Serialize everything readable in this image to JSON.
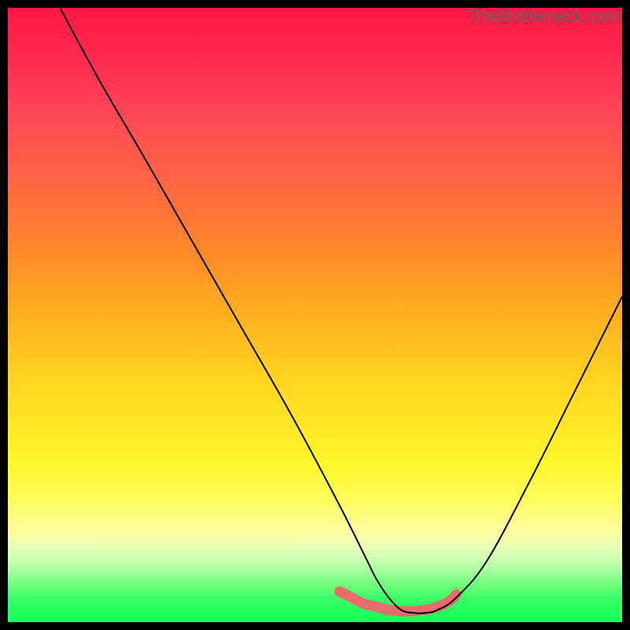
{
  "watermark": {
    "text": "TheBottleneck.com"
  },
  "chart_data": {
    "type": "line",
    "title": "",
    "xlabel": "",
    "ylabel": "",
    "xlim": [
      0,
      100
    ],
    "ylim": [
      0,
      100
    ],
    "grid": false,
    "background_gradient": {
      "direction": "top-to-bottom",
      "stops": [
        {
          "pos": 0,
          "color": "#ff1744"
        },
        {
          "pos": 50,
          "color": "#ffd21f"
        },
        {
          "pos": 85,
          "color": "#fffe9f"
        },
        {
          "pos": 100,
          "color": "#1cff5b"
        }
      ]
    },
    "series": [
      {
        "name": "bottleneck-curve",
        "color": "#000000",
        "stroke_width": 2,
        "x": [
          8.5,
          15,
          22,
          30,
          38,
          46,
          54,
          58,
          60,
          62,
          64,
          66,
          68,
          70,
          73,
          78,
          85,
          92,
          100
        ],
        "values": [
          100,
          88,
          76,
          62,
          48,
          34,
          19,
          11,
          7,
          4,
          2,
          1.5,
          1.5,
          2,
          4,
          10,
          23,
          37,
          53
        ]
      }
    ],
    "annotations": [
      {
        "name": "highlight-segment",
        "type": "overlay-stroke",
        "color": "#e86a6a",
        "stroke_width": 13,
        "linecap": "round",
        "x": [
          54,
          56,
          58,
          60,
          62,
          64,
          66,
          68,
          70,
          72,
          73
        ],
        "values": [
          5,
          4,
          3,
          2.5,
          2,
          1.8,
          1.8,
          2,
          2.5,
          3.5,
          4.5
        ]
      }
    ]
  }
}
